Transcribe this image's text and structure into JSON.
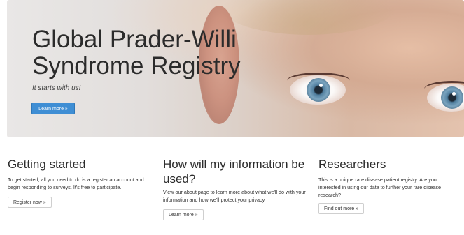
{
  "hero": {
    "title": "Global Prader-Willi Syndrome Registry",
    "tagline": "It starts with us!",
    "button_label": "Learn more »"
  },
  "columns": [
    {
      "heading": "Getting started",
      "text": "To get started, all you need to do is a register an account and begin responding to surveys. It's free to participate.",
      "button_label": "Register now »"
    },
    {
      "heading": "How will my information be used?",
      "text": "View our about page to learn more about what we'll do with your information and how we'll protect your privacy.",
      "button_label": "Learn more »"
    },
    {
      "heading": "Researchers",
      "text": "This is a unique rare disease patient registry. Are you interested in using our data to further your rare disease research?",
      "button_label": "Find out more »"
    }
  ],
  "colors": {
    "primary_button": "#3f8ed4",
    "heading_text": "#2b2b2b"
  }
}
